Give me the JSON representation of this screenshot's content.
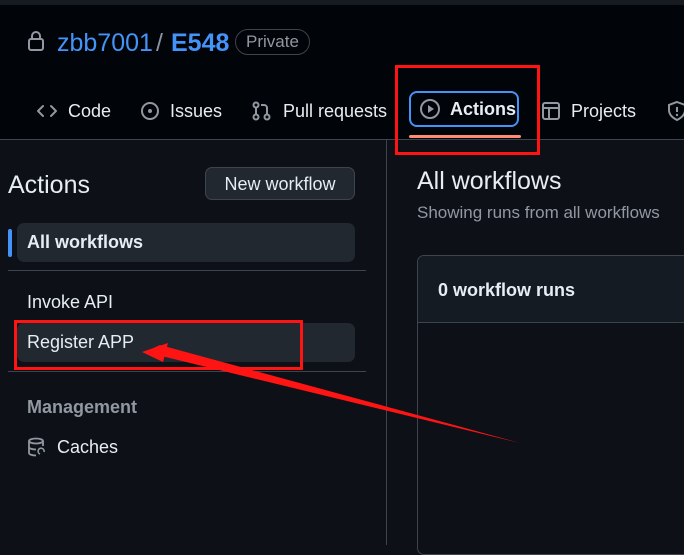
{
  "repo": {
    "owner": "zbb7001",
    "separator": "/",
    "name": "E548",
    "visibility": "Private"
  },
  "tabs": [
    {
      "label": "Code",
      "icon": "code-icon"
    },
    {
      "label": "Issues",
      "icon": "issue-icon"
    },
    {
      "label": "Pull requests",
      "icon": "pull-request-icon"
    },
    {
      "label": "Actions",
      "icon": "play-icon",
      "selected": true
    },
    {
      "label": "Projects",
      "icon": "table-icon"
    },
    {
      "label": "",
      "icon": "shield-icon"
    }
  ],
  "sidebar": {
    "title": "Actions",
    "new_workflow": "New workflow",
    "all_workflows": "All workflows",
    "workflows": [
      "Invoke API",
      "Register APP"
    ],
    "management_heading": "Management",
    "caches": "Caches"
  },
  "main": {
    "title": "All workflows",
    "subtitle": "Showing runs from all workflows",
    "runs_count": "0 workflow runs"
  },
  "colors": {
    "accent": "#4493f8",
    "tab_underline": "#fd8c73",
    "annotation": "#ff1414"
  }
}
